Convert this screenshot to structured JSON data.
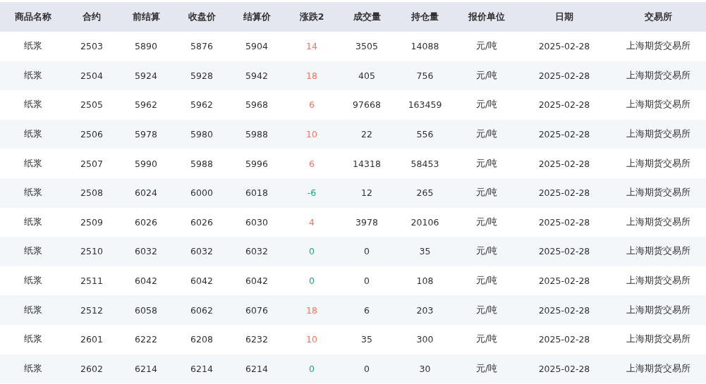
{
  "table": {
    "columns": [
      "商品名称",
      "合约",
      "前结算",
      "收盘价",
      "结算价",
      "涨跌2",
      "成交量",
      "持仓量",
      "报价单位",
      "日期",
      "交易所"
    ],
    "rows": [
      {
        "cells": [
          "纸浆",
          "2503",
          "5890",
          "5876",
          "5904",
          "14",
          "3505",
          "14088",
          "元/吨",
          "2025-02-28",
          "上海期货交易所"
        ],
        "color": "#f2735f"
      },
      {
        "cells": [
          "纸浆",
          "2504",
          "5924",
          "5928",
          "5942",
          "18",
          "405",
          "756",
          "元/吨",
          "2025-02-28",
          "上海期货交易所"
        ],
        "color": "#f2735f"
      },
      {
        "cells": [
          "纸浆",
          "2505",
          "5962",
          "5962",
          "5968",
          "6",
          "97668",
          "163459",
          "元/吨",
          "2025-02-28",
          "上海期货交易所"
        ],
        "color": "#f2735f"
      },
      {
        "cells": [
          "纸浆",
          "2506",
          "5978",
          "5980",
          "5988",
          "10",
          "22",
          "556",
          "元/吨",
          "2025-02-28",
          "上海期货交易所"
        ],
        "color": "#f2735f"
      },
      {
        "cells": [
          "纸浆",
          "2507",
          "5990",
          "5988",
          "5996",
          "6",
          "14318",
          "58453",
          "元/吨",
          "2025-02-28",
          "上海期货交易所"
        ],
        "color": "#f2735f"
      },
      {
        "cells": [
          "纸浆",
          "2508",
          "6024",
          "6000",
          "6018",
          "-6",
          "12",
          "265",
          "元/吨",
          "2025-02-28",
          "上海期货交易所"
        ],
        "color": "#1aa58a"
      },
      {
        "cells": [
          "纸浆",
          "2509",
          "6026",
          "6026",
          "6030",
          "4",
          "3978",
          "20106",
          "元/吨",
          "2025-02-28",
          "上海期货交易所"
        ],
        "color": "#f2735f"
      },
      {
        "cells": [
          "纸浆",
          "2510",
          "6032",
          "6032",
          "6032",
          "0",
          "0",
          "35",
          "元/吨",
          "2025-02-28",
          "上海期货交易所"
        ],
        "color": "#1aa58a"
      },
      {
        "cells": [
          "纸浆",
          "2511",
          "6042",
          "6042",
          "6042",
          "0",
          "0",
          "108",
          "元/吨",
          "2025-02-28",
          "上海期货交易所"
        ],
        "color": "#1aa58a"
      },
      {
        "cells": [
          "纸浆",
          "2512",
          "6058",
          "6062",
          "6076",
          "18",
          "6",
          "203",
          "元/吨",
          "2025-02-28",
          "上海期货交易所"
        ],
        "color": "#f2735f"
      },
      {
        "cells": [
          "纸浆",
          "2601",
          "6222",
          "6208",
          "6232",
          "10",
          "35",
          "300",
          "元/吨",
          "2025-02-28",
          "上海期货交易所"
        ],
        "color": "#f2735f"
      },
      {
        "cells": [
          "纸浆",
          "2602",
          "6214",
          "6214",
          "6214",
          "0",
          "0",
          "30",
          "元/吨",
          "2025-02-28",
          "上海期货交易所"
        ],
        "color": "#1aa58a"
      }
    ]
  }
}
